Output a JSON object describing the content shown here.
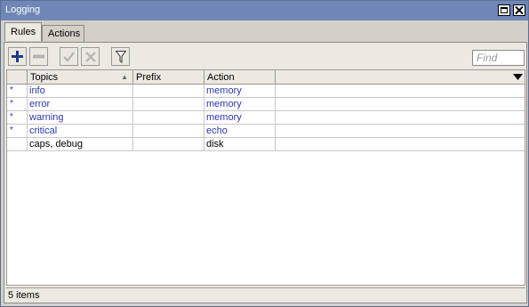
{
  "window": {
    "title": "Logging"
  },
  "tabs": [
    {
      "label": "Rules",
      "active": true
    },
    {
      "label": "Actions",
      "active": false
    }
  ],
  "toolbar": {
    "buttons": [
      {
        "icon": "add-icon",
        "enabled": true
      },
      {
        "icon": "remove-icon",
        "enabled": false
      },
      {
        "icon": "enable-check-icon",
        "enabled": false
      },
      {
        "icon": "disable-x-icon",
        "enabled": false
      },
      {
        "icon": "filter-icon",
        "enabled": true
      }
    ],
    "find_placeholder": "Find"
  },
  "table": {
    "columns": [
      "Topics",
      "Prefix",
      "Action"
    ],
    "rows": [
      {
        "flag": "*",
        "topics": "info",
        "prefix": "",
        "action": "memory",
        "default": true
      },
      {
        "flag": "*",
        "topics": "error",
        "prefix": "",
        "action": "memory",
        "default": true
      },
      {
        "flag": "*",
        "topics": "warning",
        "prefix": "",
        "action": "memory",
        "default": true
      },
      {
        "flag": "*",
        "topics": "critical",
        "prefix": "",
        "action": "echo",
        "default": true
      },
      {
        "flag": "",
        "topics": "caps, debug",
        "prefix": "",
        "action": "disk",
        "default": false
      }
    ]
  },
  "status": {
    "text": "5 items"
  },
  "colors": {
    "titlebar": "#6f86b6",
    "default_row_text": "#2b3aa8",
    "normal_row_text": "#000000",
    "add_icon": "#1d3b8c"
  }
}
